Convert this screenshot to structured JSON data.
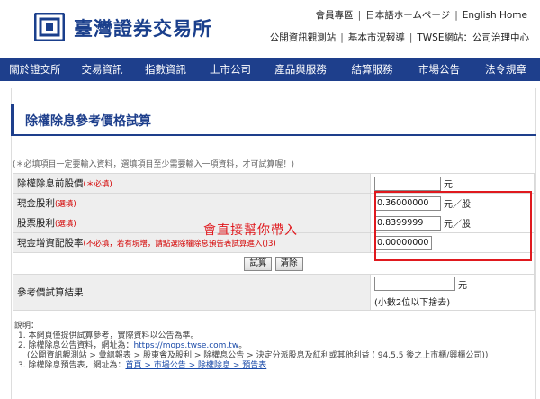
{
  "header": {
    "logo_text": "臺灣證券交易所",
    "top_links": [
      "會員專區",
      "日本語ホームページ",
      "English Home"
    ],
    "sub_links": [
      "公開資訊觀測站",
      "基本市況報導",
      "TWSE網站：公司治理中心"
    ]
  },
  "nav": {
    "items": [
      "關於證交所",
      "交易資訊",
      "指數資訊",
      "上市公司",
      "產品與服務",
      "結算服務",
      "市場公告",
      "法令規章"
    ]
  },
  "page": {
    "title": "除權除息參考價格試算",
    "note": "(＊必填項目一定要輸入資料，選填項目至少需要輸入一項資料，才可試算喔！)"
  },
  "form": {
    "rows": [
      {
        "label": "除權除息前股價",
        "tag": "(＊必填)",
        "value": "",
        "unit": "元"
      },
      {
        "label": "現金股利",
        "tag": "(選填)",
        "value": "0.36000000",
        "unit": "元／股"
      },
      {
        "label": "股票股利",
        "tag": "(選填)",
        "value": "0.8399999",
        "unit": "元／股"
      },
      {
        "label": "現金增資配股率",
        "tag": "(不必填，若有現增，請點選除權除息預告表試算進入()3)",
        "value": "0.00000000",
        "unit": ""
      }
    ],
    "calc_button": "試算",
    "clear_button": "清除",
    "result_label": "參考價試算結果",
    "result_value": "",
    "result_unit": "元",
    "result_note": "(小數2位以下捨去)"
  },
  "annotation": "會直接幫你帶入",
  "footer": {
    "heading": "說明：",
    "line1": "1. 本網頁僅提供試算參考，實際資料以公告為準。",
    "line2_prefix": "2. 除權除息公告資料，網址為：",
    "line2_link": "https://mops.twse.com.tw",
    "line2_suffix": "。",
    "line3": "(公開資訊觀測站 > 彙總報表 > 股東會及股利 > 除權息公告 > 決定分派股息及紅利或其他利益 ( 94.5.5 後之上市櫃/興櫃公司))",
    "line4_prefix": "3. 除權除息預告表，網址為：",
    "line4_link": "首頁 > 市場公告 > 除權除息 > 預告表"
  },
  "colors": {
    "brand": "#1e3f8c",
    "highlight": "#e0191e",
    "required": "#d40000"
  }
}
